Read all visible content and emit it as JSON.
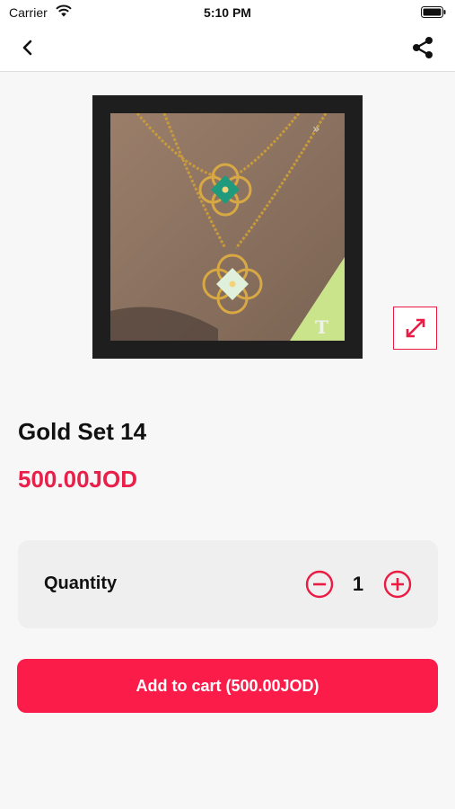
{
  "status_bar": {
    "carrier": "Carrier",
    "time": "5:10 PM",
    "wifi_icon": "wifi-icon",
    "battery_icon": "battery-icon"
  },
  "nav": {
    "back_icon": "chevron-left-icon",
    "share_icon": "share-icon"
  },
  "product": {
    "image_alt": "necklace-photo",
    "expand_icon": "expand-arrows-icon",
    "title": "Gold Set 14",
    "price": "500.00JOD"
  },
  "quantity": {
    "label": "Quantity",
    "value": "1",
    "minus_icon": "minus-circle-icon",
    "plus_icon": "plus-circle-icon"
  },
  "cart": {
    "button_label": "Add to cart (500.00JOD)"
  },
  "colors": {
    "accent": "#fc1c49",
    "price": "#e8204a",
    "background": "#f7f7f7",
    "card": "#efefef"
  }
}
